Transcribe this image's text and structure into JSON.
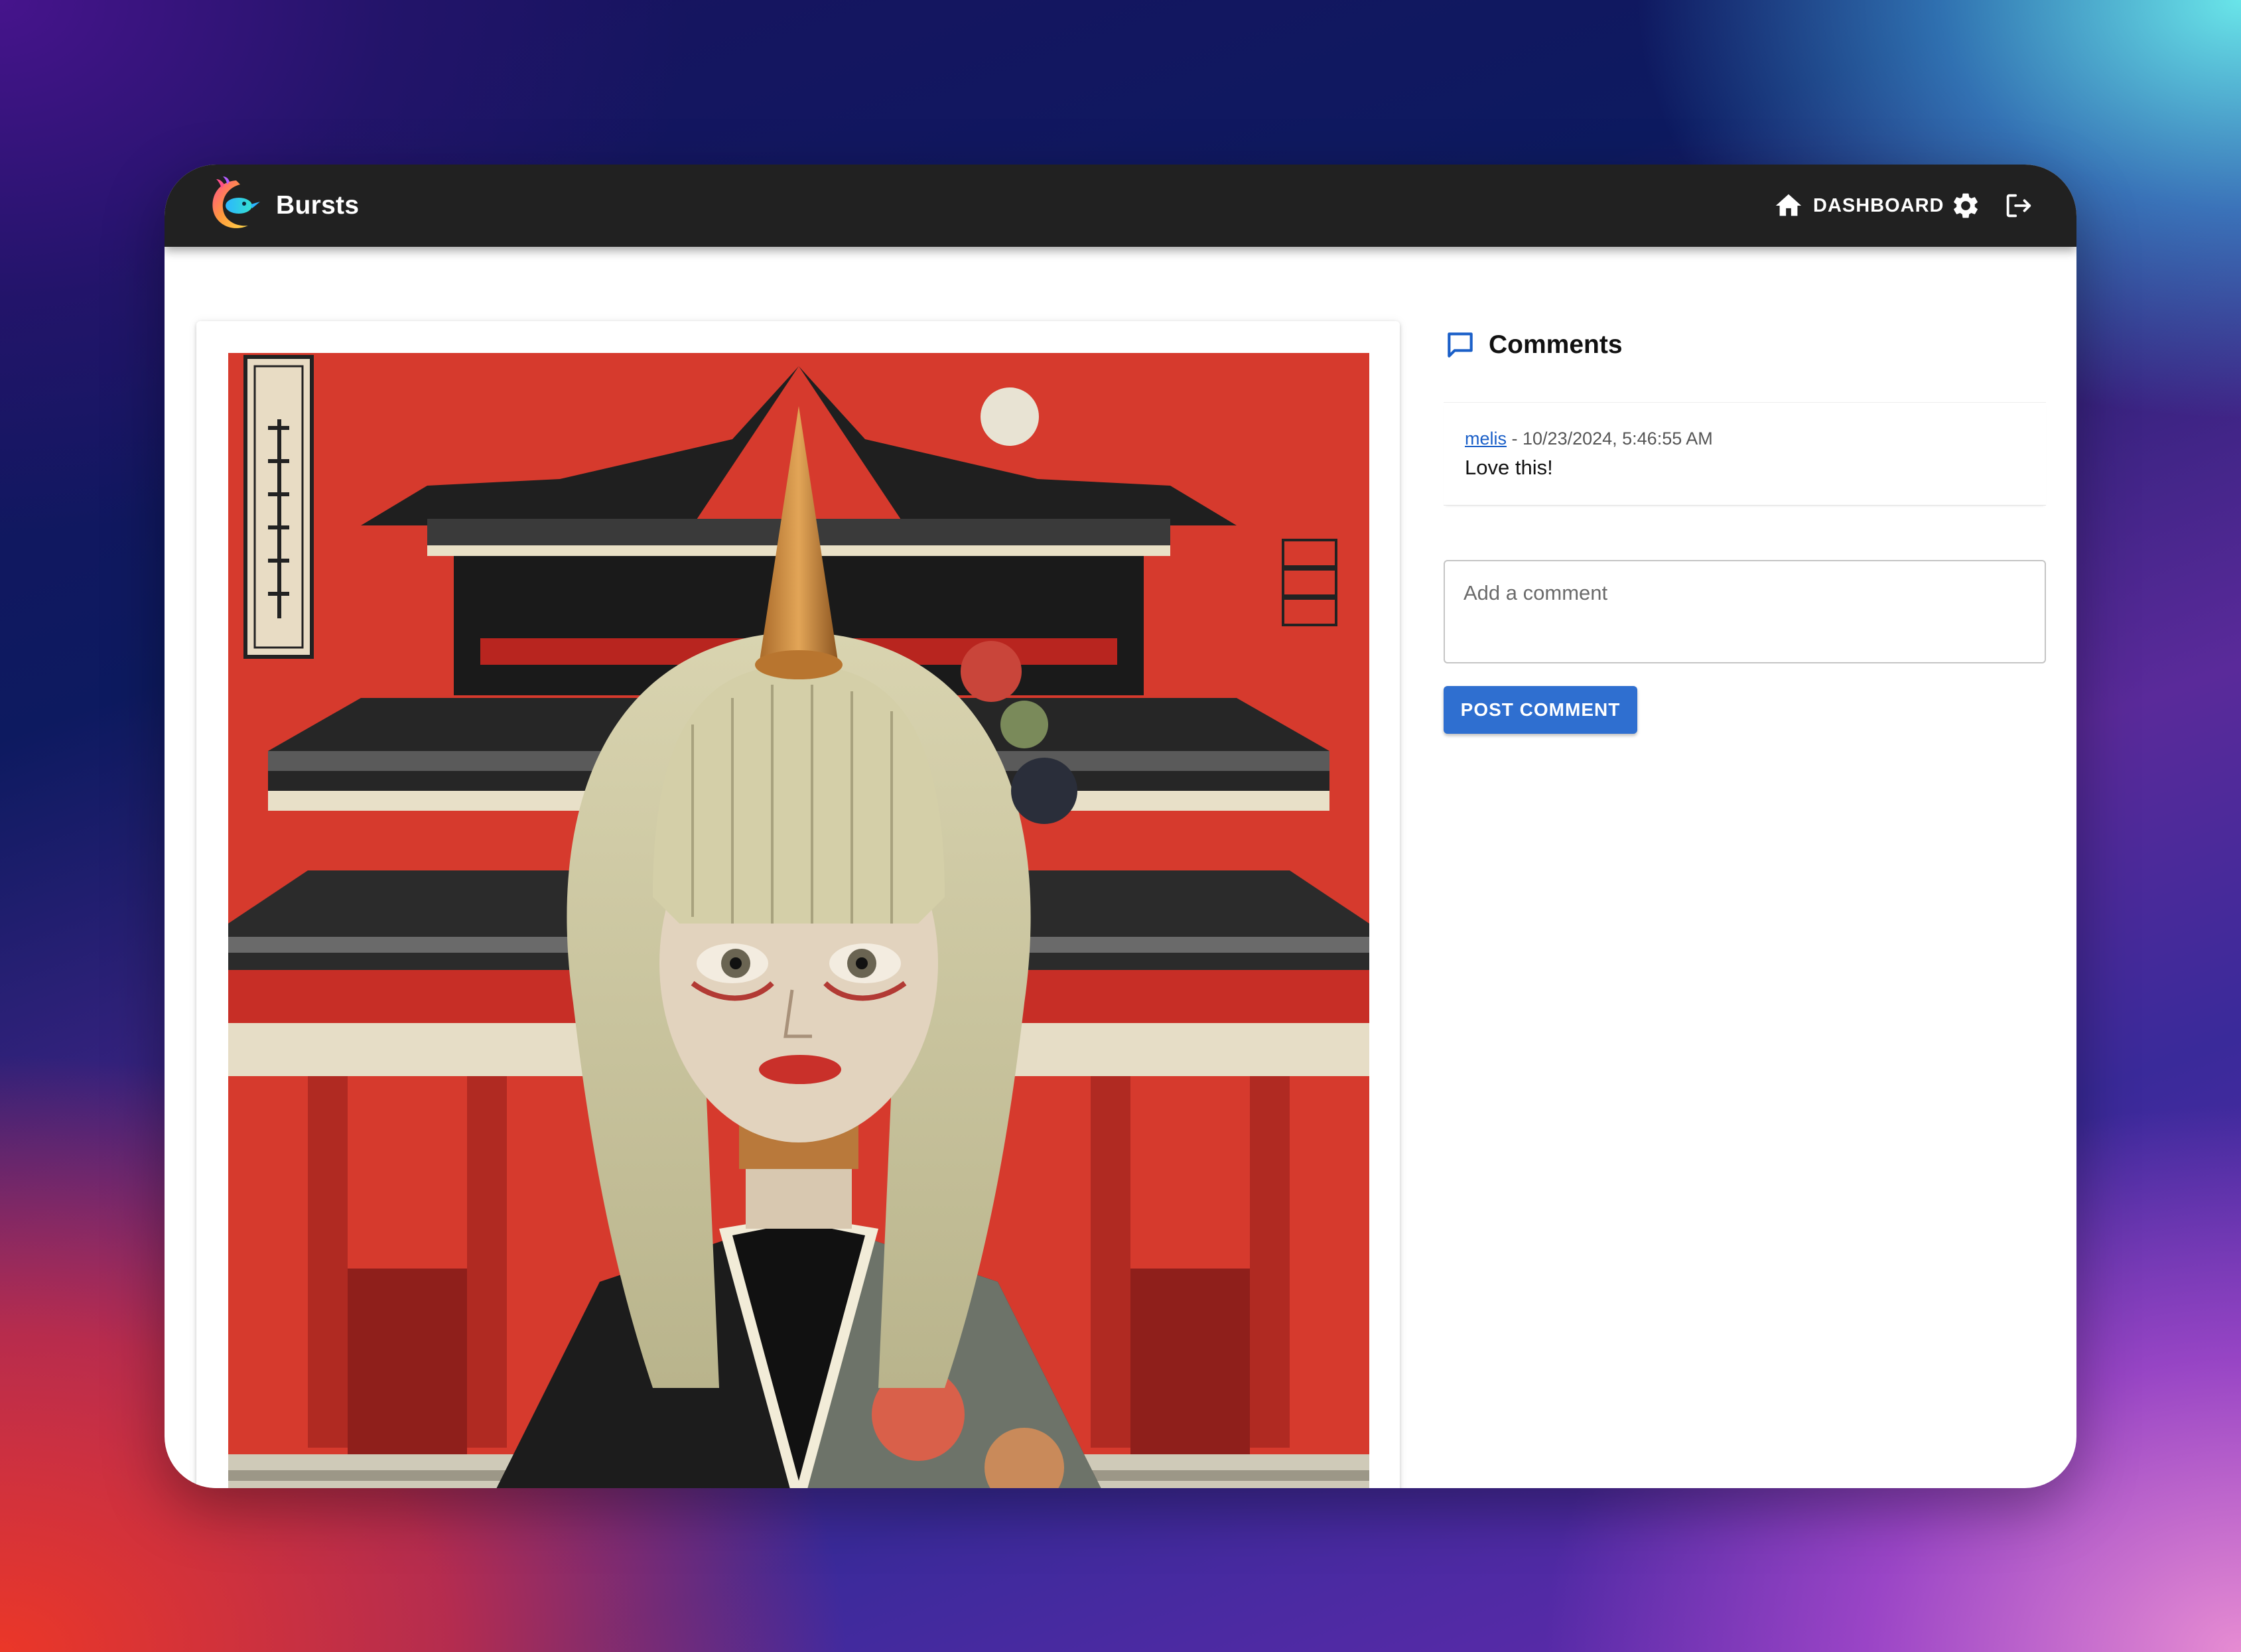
{
  "app": {
    "brand": "Bursts"
  },
  "nav": {
    "dashboard_label": "DASHBOARD",
    "dashboard_icon": "home-icon",
    "settings_icon": "gear-icon",
    "logout_icon": "logout-icon"
  },
  "comments": {
    "title": "Comments",
    "icon": "comment-icon",
    "items": [
      {
        "author": "melis",
        "separator": " - ",
        "timestamp": "10/23/2024, 5:46:55 AM",
        "text": "Love this!"
      }
    ],
    "input_placeholder": "Add a comment",
    "input_value": "",
    "post_label": "POST COMMENT"
  },
  "colors": {
    "appbar": "#212121",
    "accent": "#2f6fd0",
    "link": "#1a5fc8"
  }
}
